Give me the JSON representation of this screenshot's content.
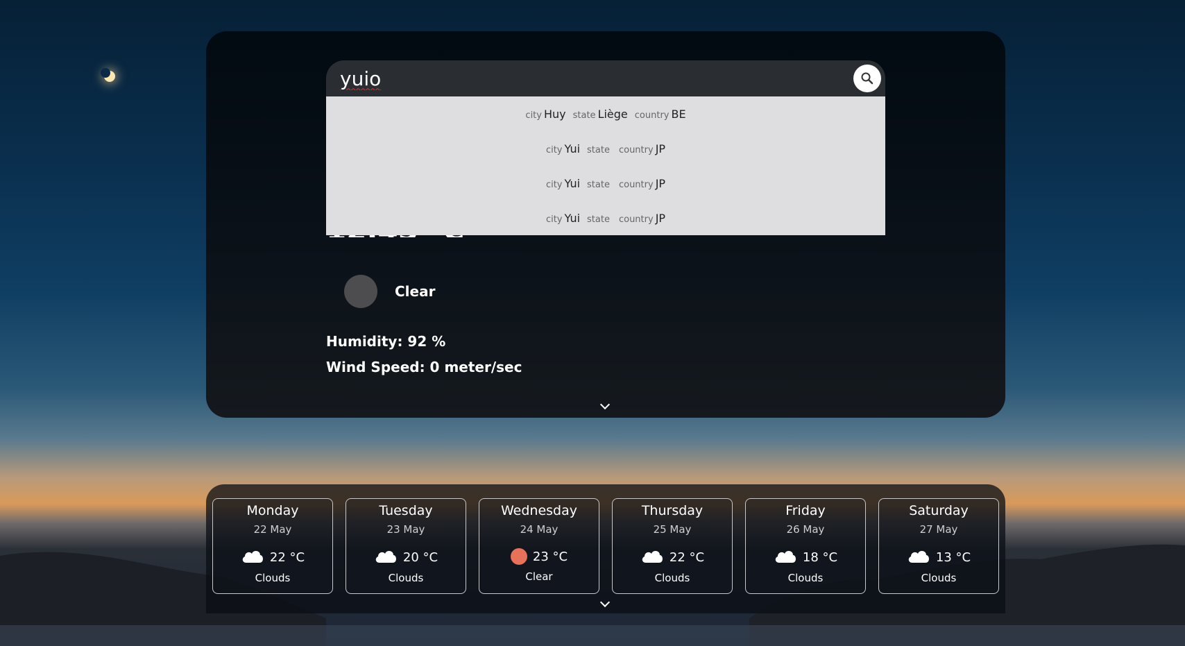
{
  "search": {
    "value": "yuio"
  },
  "suggestions": [
    {
      "city_label": "city",
      "city": "Huy",
      "state_label": "state",
      "state": "Liège",
      "country_label": "country",
      "country": "BE"
    },
    {
      "city_label": "city",
      "city": "Yui",
      "state_label": "state",
      "state": "",
      "country_label": "country",
      "country": "JP"
    },
    {
      "city_label": "city",
      "city": "Yui",
      "state_label": "state",
      "state": "",
      "country_label": "country",
      "country": "JP"
    },
    {
      "city_label": "city",
      "city": "Yui",
      "state_label": "state",
      "state": "",
      "country_label": "country",
      "country": "JP"
    }
  ],
  "current": {
    "condition": "Clear",
    "humidity": "Humidity: 92 %",
    "wind": "Wind Speed: 0 meter/sec"
  },
  "forecast": [
    {
      "day": "Monday",
      "date": "22 May",
      "temp": "22 °C",
      "condition": "Clouds",
      "icon": "cloud-icon"
    },
    {
      "day": "Tuesday",
      "date": "23 May",
      "temp": "20 °C",
      "condition": "Clouds",
      "icon": "cloud-icon"
    },
    {
      "day": "Wednesday",
      "date": "24 May",
      "temp": "23 °C",
      "condition": "Clear",
      "icon": "sun-icon"
    },
    {
      "day": "Thursday",
      "date": "25 May",
      "temp": "22 °C",
      "condition": "Clouds",
      "icon": "cloud-icon"
    },
    {
      "day": "Friday",
      "date": "26 May",
      "temp": "18 °C",
      "condition": "Clouds",
      "icon": "cloud-icon"
    },
    {
      "day": "Saturday",
      "date": "27 May",
      "temp": "13 °C",
      "condition": "Clouds",
      "icon": "cloud-icon"
    }
  ],
  "colors": {
    "clear_icon": "#e8715a",
    "dropdown_bg": "#dedddf"
  }
}
